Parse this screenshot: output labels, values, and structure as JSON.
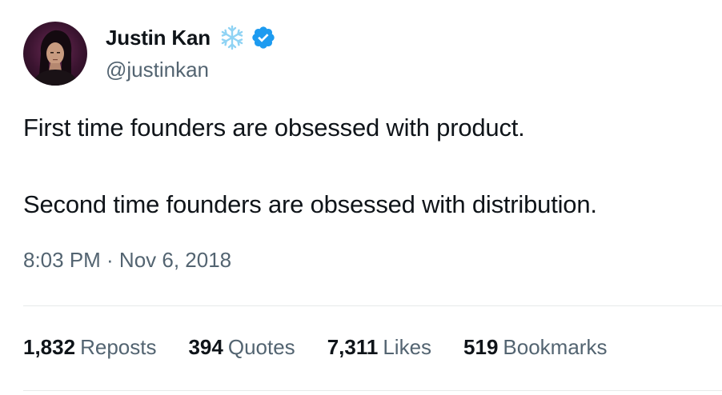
{
  "author": {
    "display_name": "Justin Kan",
    "handle": "@justinkan",
    "badge_emoji_icon": "snowflake-icon",
    "verified_icon": "verified-badge-icon",
    "verified_color": "#1d9bf0"
  },
  "tweet": {
    "lines": [
      "First time founders are obsessed with product.",
      "Second time founders are obsessed with distribution."
    ],
    "timestamp": "8:03 PM · Nov 6, 2018"
  },
  "stats": [
    {
      "count": "1,832",
      "label": "Reposts"
    },
    {
      "count": "394",
      "label": "Quotes"
    },
    {
      "count": "7,311",
      "label": "Likes"
    },
    {
      "count": "519",
      "label": "Bookmarks"
    }
  ],
  "colors": {
    "text_primary": "#0f1419",
    "text_secondary": "#536471",
    "divider": "#e7e9ea",
    "snowflake": "#8fd3f4"
  }
}
